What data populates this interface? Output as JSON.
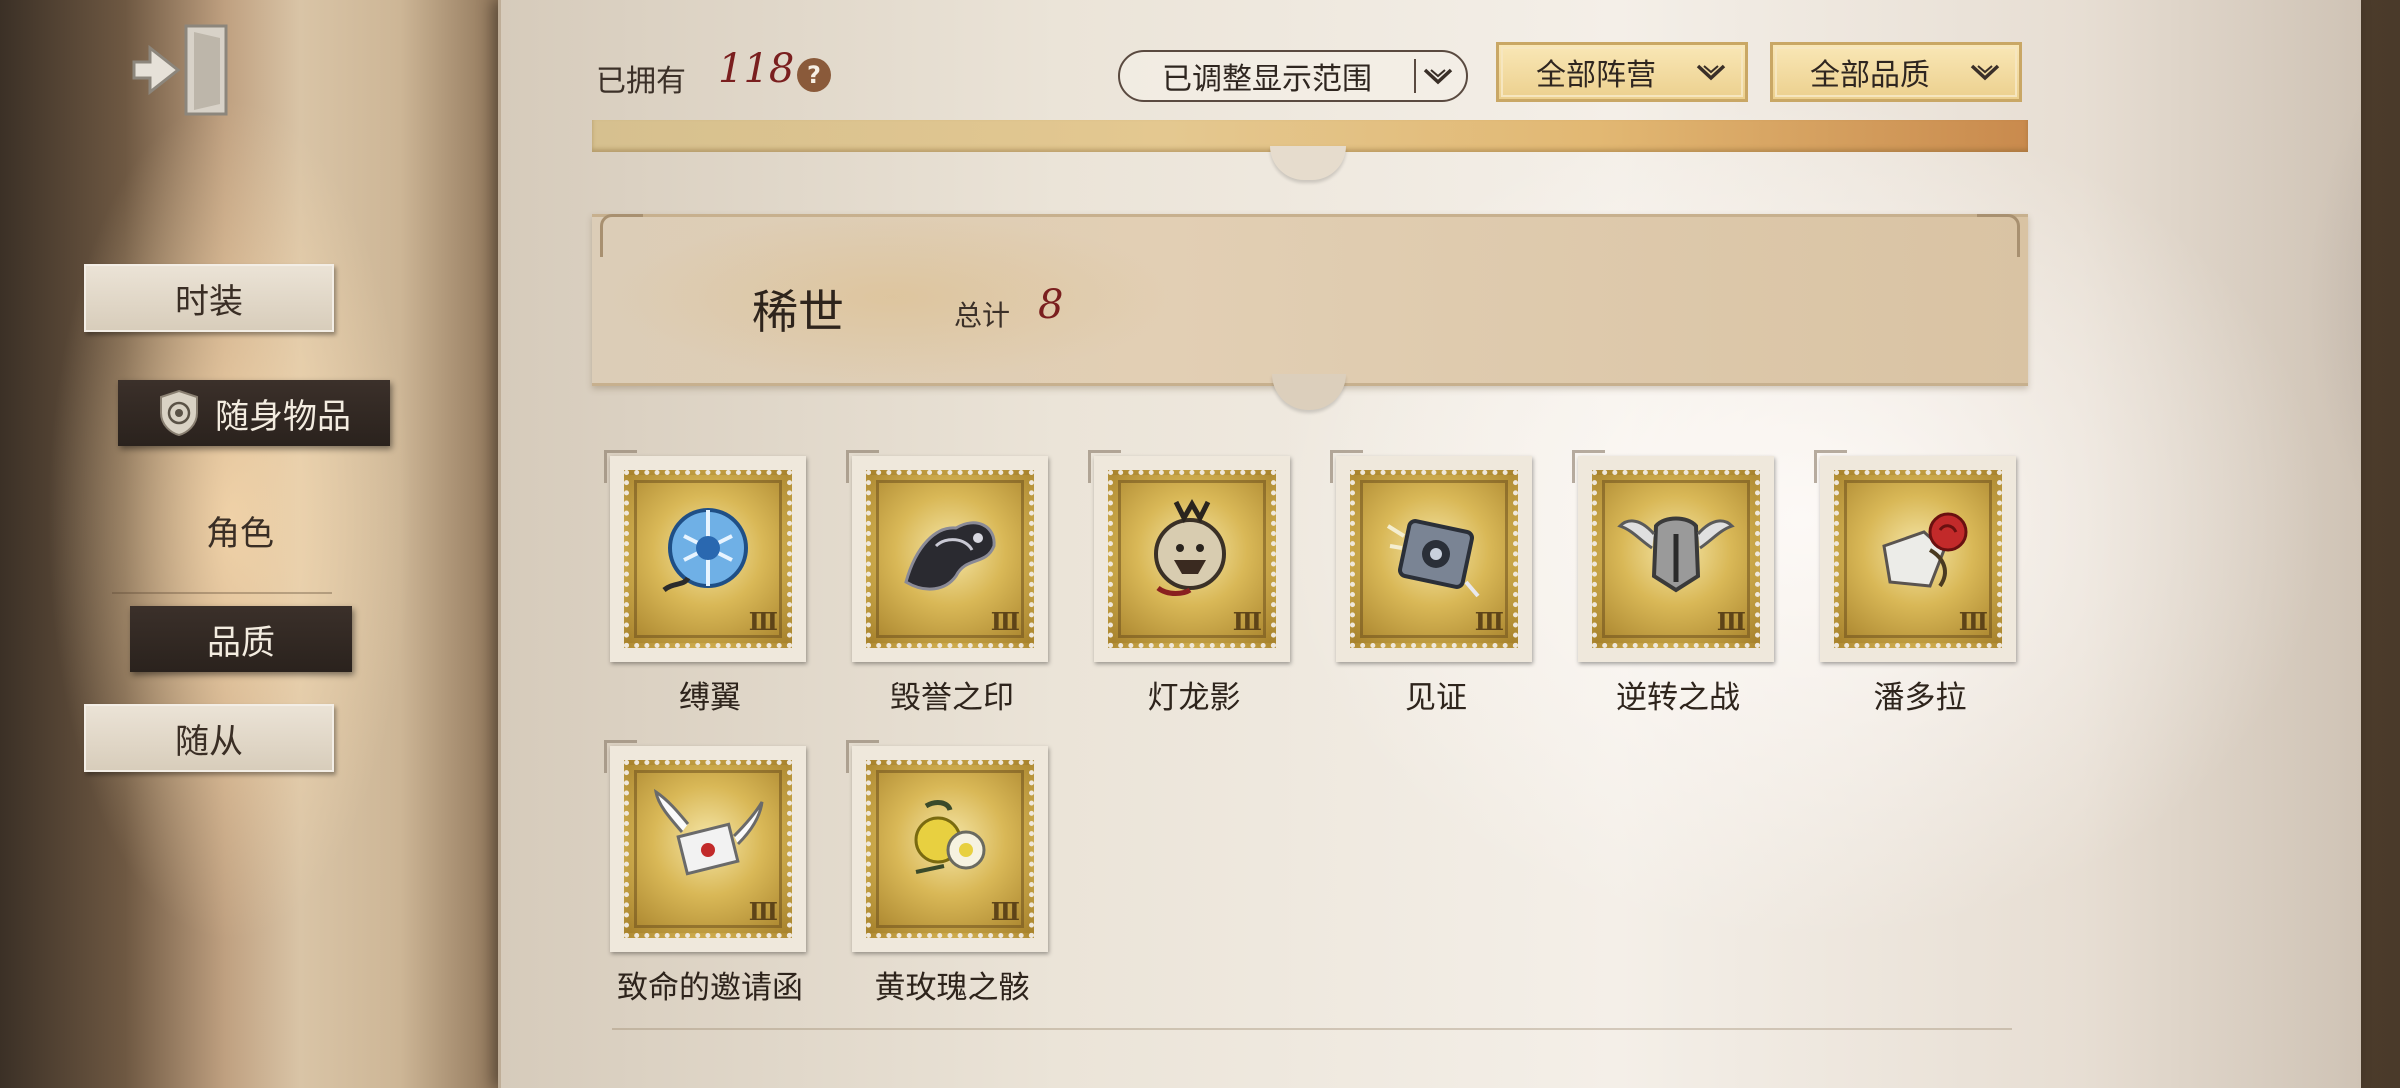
{
  "sidebar": {
    "nav": [
      {
        "label": "时装",
        "style": "paper"
      },
      {
        "label": "随身物品",
        "style": "dark",
        "icon": "crest-icon"
      },
      {
        "label": "角色",
        "style": "plain"
      },
      {
        "label": "品质",
        "style": "dark"
      },
      {
        "label": "随从",
        "style": "paper"
      }
    ]
  },
  "header": {
    "owned_label": "已拥有",
    "owned_count": "118",
    "help_symbol": "?",
    "range_filter": "已调整显示范围",
    "faction_filter": "全部阵营",
    "quality_filter": "全部品质"
  },
  "section": {
    "title": "稀世",
    "total_label": "总计",
    "total_count": "8"
  },
  "items": [
    {
      "name": "缚翼",
      "art": "blue-orb-icon",
      "accent": "#3a7fc4"
    },
    {
      "name": "毁誉之印",
      "art": "dark-beast-icon",
      "accent": "#2a2a30"
    },
    {
      "name": "灯龙影",
      "art": "lantern-icon",
      "accent": "#c4b9a0"
    },
    {
      "name": "见证",
      "art": "camera-icon",
      "accent": "#7a8494"
    },
    {
      "name": "逆转之战",
      "art": "winged-helmet-icon",
      "accent": "#9a9a9a"
    },
    {
      "name": "潘多拉",
      "art": "rose-box-icon",
      "accent": "#c22a2a"
    },
    {
      "name": "致命的邀请函",
      "art": "winged-letter-icon",
      "accent": "#f2f2f2"
    },
    {
      "name": "黄玫瑰之骸",
      "art": "yellow-rose-icon",
      "accent": "#e8d040"
    }
  ],
  "colors": {
    "count_red": "#7a1f1f",
    "gold_button": "#ecd08e",
    "dark_tab": "#2a221d"
  }
}
